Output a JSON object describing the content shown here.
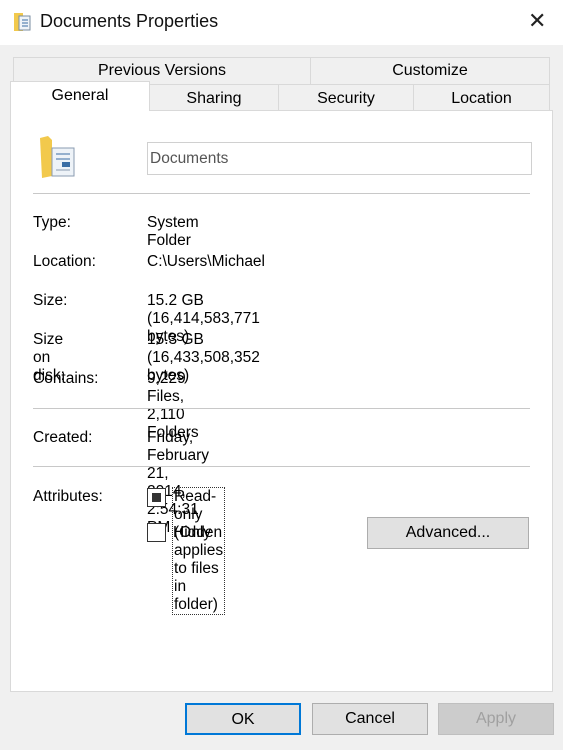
{
  "window": {
    "title": "Documents Properties",
    "icon": "documents-folder-icon",
    "close_icon": "close-icon",
    "close_glyph": "✕"
  },
  "tabs": {
    "row1": [
      {
        "label": "Previous Versions"
      },
      {
        "label": "Customize"
      }
    ],
    "row2": [
      {
        "label": "General",
        "active": true
      },
      {
        "label": "Sharing"
      },
      {
        "label": "Security"
      },
      {
        "label": "Location"
      }
    ]
  },
  "general": {
    "name_value": "Documents",
    "fields": [
      {
        "label": "Type:",
        "value": "System Folder"
      },
      {
        "label": "Location:",
        "value": "C:\\Users\\Michael"
      },
      {
        "label": "Size:",
        "value": "15.2 GB (16,414,583,771 bytes)"
      },
      {
        "label": "Size on disk:",
        "value": "15.3 GB (16,433,508,352 bytes)"
      },
      {
        "label": "Contains:",
        "value": "9,229 Files, 2,110 Folders"
      }
    ],
    "created": {
      "label": "Created:",
      "value": "Friday, February 21, 2014, 2:54:31 PM"
    },
    "attributes": {
      "label": "Attributes:",
      "readonly": {
        "label": "Read-only (Only applies to files in folder)",
        "state": "indeterminate"
      },
      "hidden": {
        "label": "Hidden",
        "checked": false
      },
      "advanced_label": "Advanced..."
    }
  },
  "buttons": {
    "ok": "OK",
    "cancel": "Cancel",
    "apply": "Apply",
    "apply_disabled": true
  },
  "colors": {
    "focus_border": "#0078d7",
    "disabled_text": "#a0a0a0"
  }
}
